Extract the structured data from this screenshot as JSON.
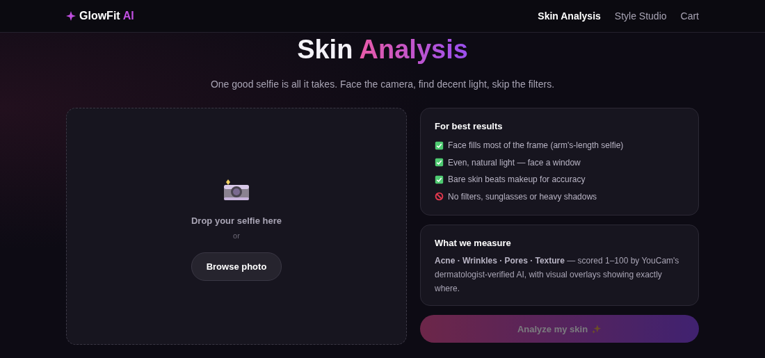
{
  "nav": {
    "brand": "GlowFit",
    "brand_accent": "AI",
    "links": [
      {
        "label": "Skin Analysis",
        "selected": true
      },
      {
        "label": "Style Studio",
        "selected": false
      },
      {
        "label": "Cart",
        "selected": false
      }
    ]
  },
  "header": {
    "title": "Skin",
    "title_accent": "Analysis",
    "subtitle": "One good selfie is all it takes. Face the camera, find decent light, skip the filters."
  },
  "upload": {
    "prompt": "Drop your selfie here",
    "separator": "or",
    "button": "Browse photo"
  },
  "tips": {
    "title": "For best results",
    "items": [
      {
        "kind": "do",
        "text": "Face fills most of the frame (arm's-length selfie)"
      },
      {
        "kind": "do",
        "text": "Even, natural light — face a window"
      },
      {
        "kind": "do",
        "text": "Bare skin beats makeup for accuracy"
      },
      {
        "kind": "dont",
        "text": "No filters, sunglasses or heavy shadows"
      }
    ]
  },
  "measure": {
    "title": "What we measure",
    "text": "**Acne · Wrinkles · Pores · Texture** — scored 1–100 by YouCam's dermatologist-verified AI, with visual overlays showing exactly where."
  },
  "analyze_button": {
    "label": "Analyze my skin",
    "disabled": true
  }
}
